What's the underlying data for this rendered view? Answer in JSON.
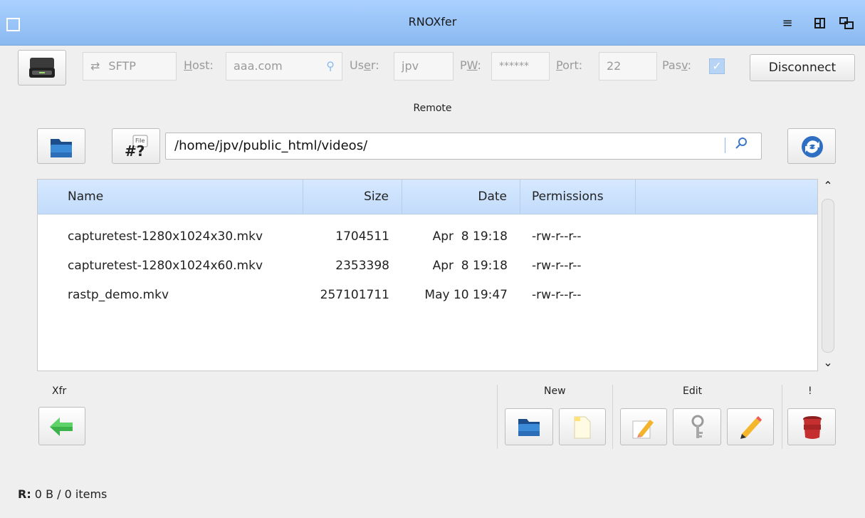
{
  "window": {
    "title": "RNOXfer"
  },
  "connection": {
    "protocol": "SFTP",
    "host_label": "Host:",
    "host_value": "aaa.com",
    "user_label": "User:",
    "user_value": "jpv",
    "pw_label": "PW:",
    "pw_value": "******",
    "port_label": "Port:",
    "port_value": "22",
    "pasv_label": "Pasv:",
    "disconnect_label": "Disconnect"
  },
  "remote": {
    "label": "Remote",
    "path": "/home/jpv/public_html/videos/"
  },
  "table": {
    "headers": {
      "name": "Name",
      "size": "Size",
      "date": "Date",
      "permissions": "Permissions"
    },
    "rows": [
      {
        "name": "capturetest-1280x1024x30.mkv",
        "size": "1704511",
        "date": "Apr  8 19:18",
        "permissions": "-rw-r--r--"
      },
      {
        "name": "capturetest-1280x1024x60.mkv",
        "size": "2353398",
        "date": "Apr  8 19:18",
        "permissions": "-rw-r--r--"
      },
      {
        "name": "rastp_demo.mkv",
        "size": "257101711",
        "date": "May 10 19:47",
        "permissions": "-rw-r--r--"
      }
    ]
  },
  "toolbar": {
    "xfr_label": "Xfr",
    "new_label": "New",
    "edit_label": "Edit",
    "danger_label": "!"
  },
  "status": {
    "prefix": "R:",
    "text": " 0 B / 0 items"
  },
  "colors": {
    "titlebar": "#9cc4f5",
    "header": "#cbe1fc",
    "accent": "#3d78c8"
  }
}
